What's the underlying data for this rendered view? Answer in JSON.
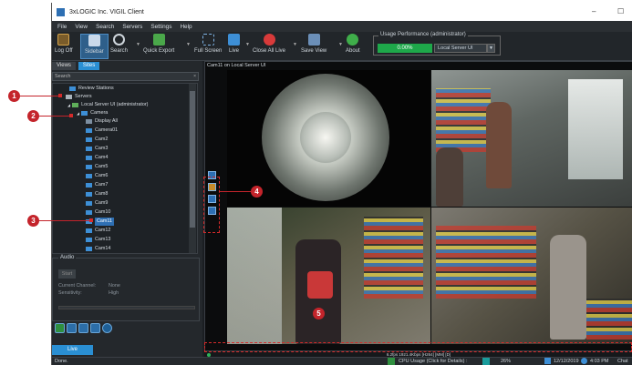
{
  "window": {
    "title": "3xLOGIC Inc. VIGIL Client",
    "controls": [
      "–",
      "☐"
    ]
  },
  "menu": [
    "File",
    "View",
    "Search",
    "Servers",
    "Settings",
    "Help"
  ],
  "toolbar": {
    "log_off": "Log Off",
    "sidebar": "Sidebar",
    "search": "Search",
    "quick_export": "Quick Export",
    "full_screen": "Full Screen",
    "live": "Live",
    "close_all_live": "Close All Live",
    "save_view": "Save View",
    "about": "About"
  },
  "usage": {
    "label": "Usage Performance (administrator)",
    "value": "0.00%",
    "server": "Local Server UI",
    "accent": "#1ea84a"
  },
  "left_panel": {
    "tabs": [
      "Views",
      "Sites"
    ],
    "active_tab": "Sites",
    "search_placeholder": "Search",
    "tree": [
      {
        "label": "Review Stations",
        "level": 1
      },
      {
        "label": "Servers",
        "level": 0
      },
      {
        "label": "Local Server UI (administrator)",
        "level": 1
      },
      {
        "label": "Camera",
        "level": 2
      },
      {
        "label": "Display All",
        "level": 3
      },
      {
        "label": "Camera01",
        "level": 3
      },
      {
        "label": "Cam2",
        "level": 3
      },
      {
        "label": "Cam3",
        "level": 3
      },
      {
        "label": "Cam4",
        "level": 3
      },
      {
        "label": "Cam5",
        "level": 3
      },
      {
        "label": "Cam6",
        "level": 3
      },
      {
        "label": "Cam7",
        "level": 3
      },
      {
        "label": "Cam8",
        "level": 3
      },
      {
        "label": "Cam9",
        "level": 3
      },
      {
        "label": "Cam10",
        "level": 3
      },
      {
        "label": "Cam11",
        "level": 3,
        "selected": true
      },
      {
        "label": "Cam12",
        "level": 3
      },
      {
        "label": "Cam13",
        "level": 3
      },
      {
        "label": "Cam14",
        "level": 3
      }
    ],
    "audio": {
      "title": "Audio",
      "start": "Start",
      "current_channel_label": "Current Channel:",
      "current_channel_value": "None",
      "sensitivity_label": "Sensitivity:",
      "sensitivity_value": "High"
    },
    "bottom_tab": "Live"
  },
  "video": {
    "title": "Cam11 on Local Server UI",
    "stream_info": "6.2fps 1921.4Kbps [H264] [MM] [D]"
  },
  "status_bar": {
    "left": "Done.",
    "cpu_label": "CPU Usage (Click for Details) :",
    "cpu_value": "26%",
    "date": "12/12/2019",
    "time": "4:03 PM",
    "chat": "Chat Of"
  },
  "callouts": [
    "1",
    "2",
    "3",
    "4",
    "5"
  ],
  "colors": {
    "selection": "#2e6fb3",
    "callout": "#c4242b"
  }
}
